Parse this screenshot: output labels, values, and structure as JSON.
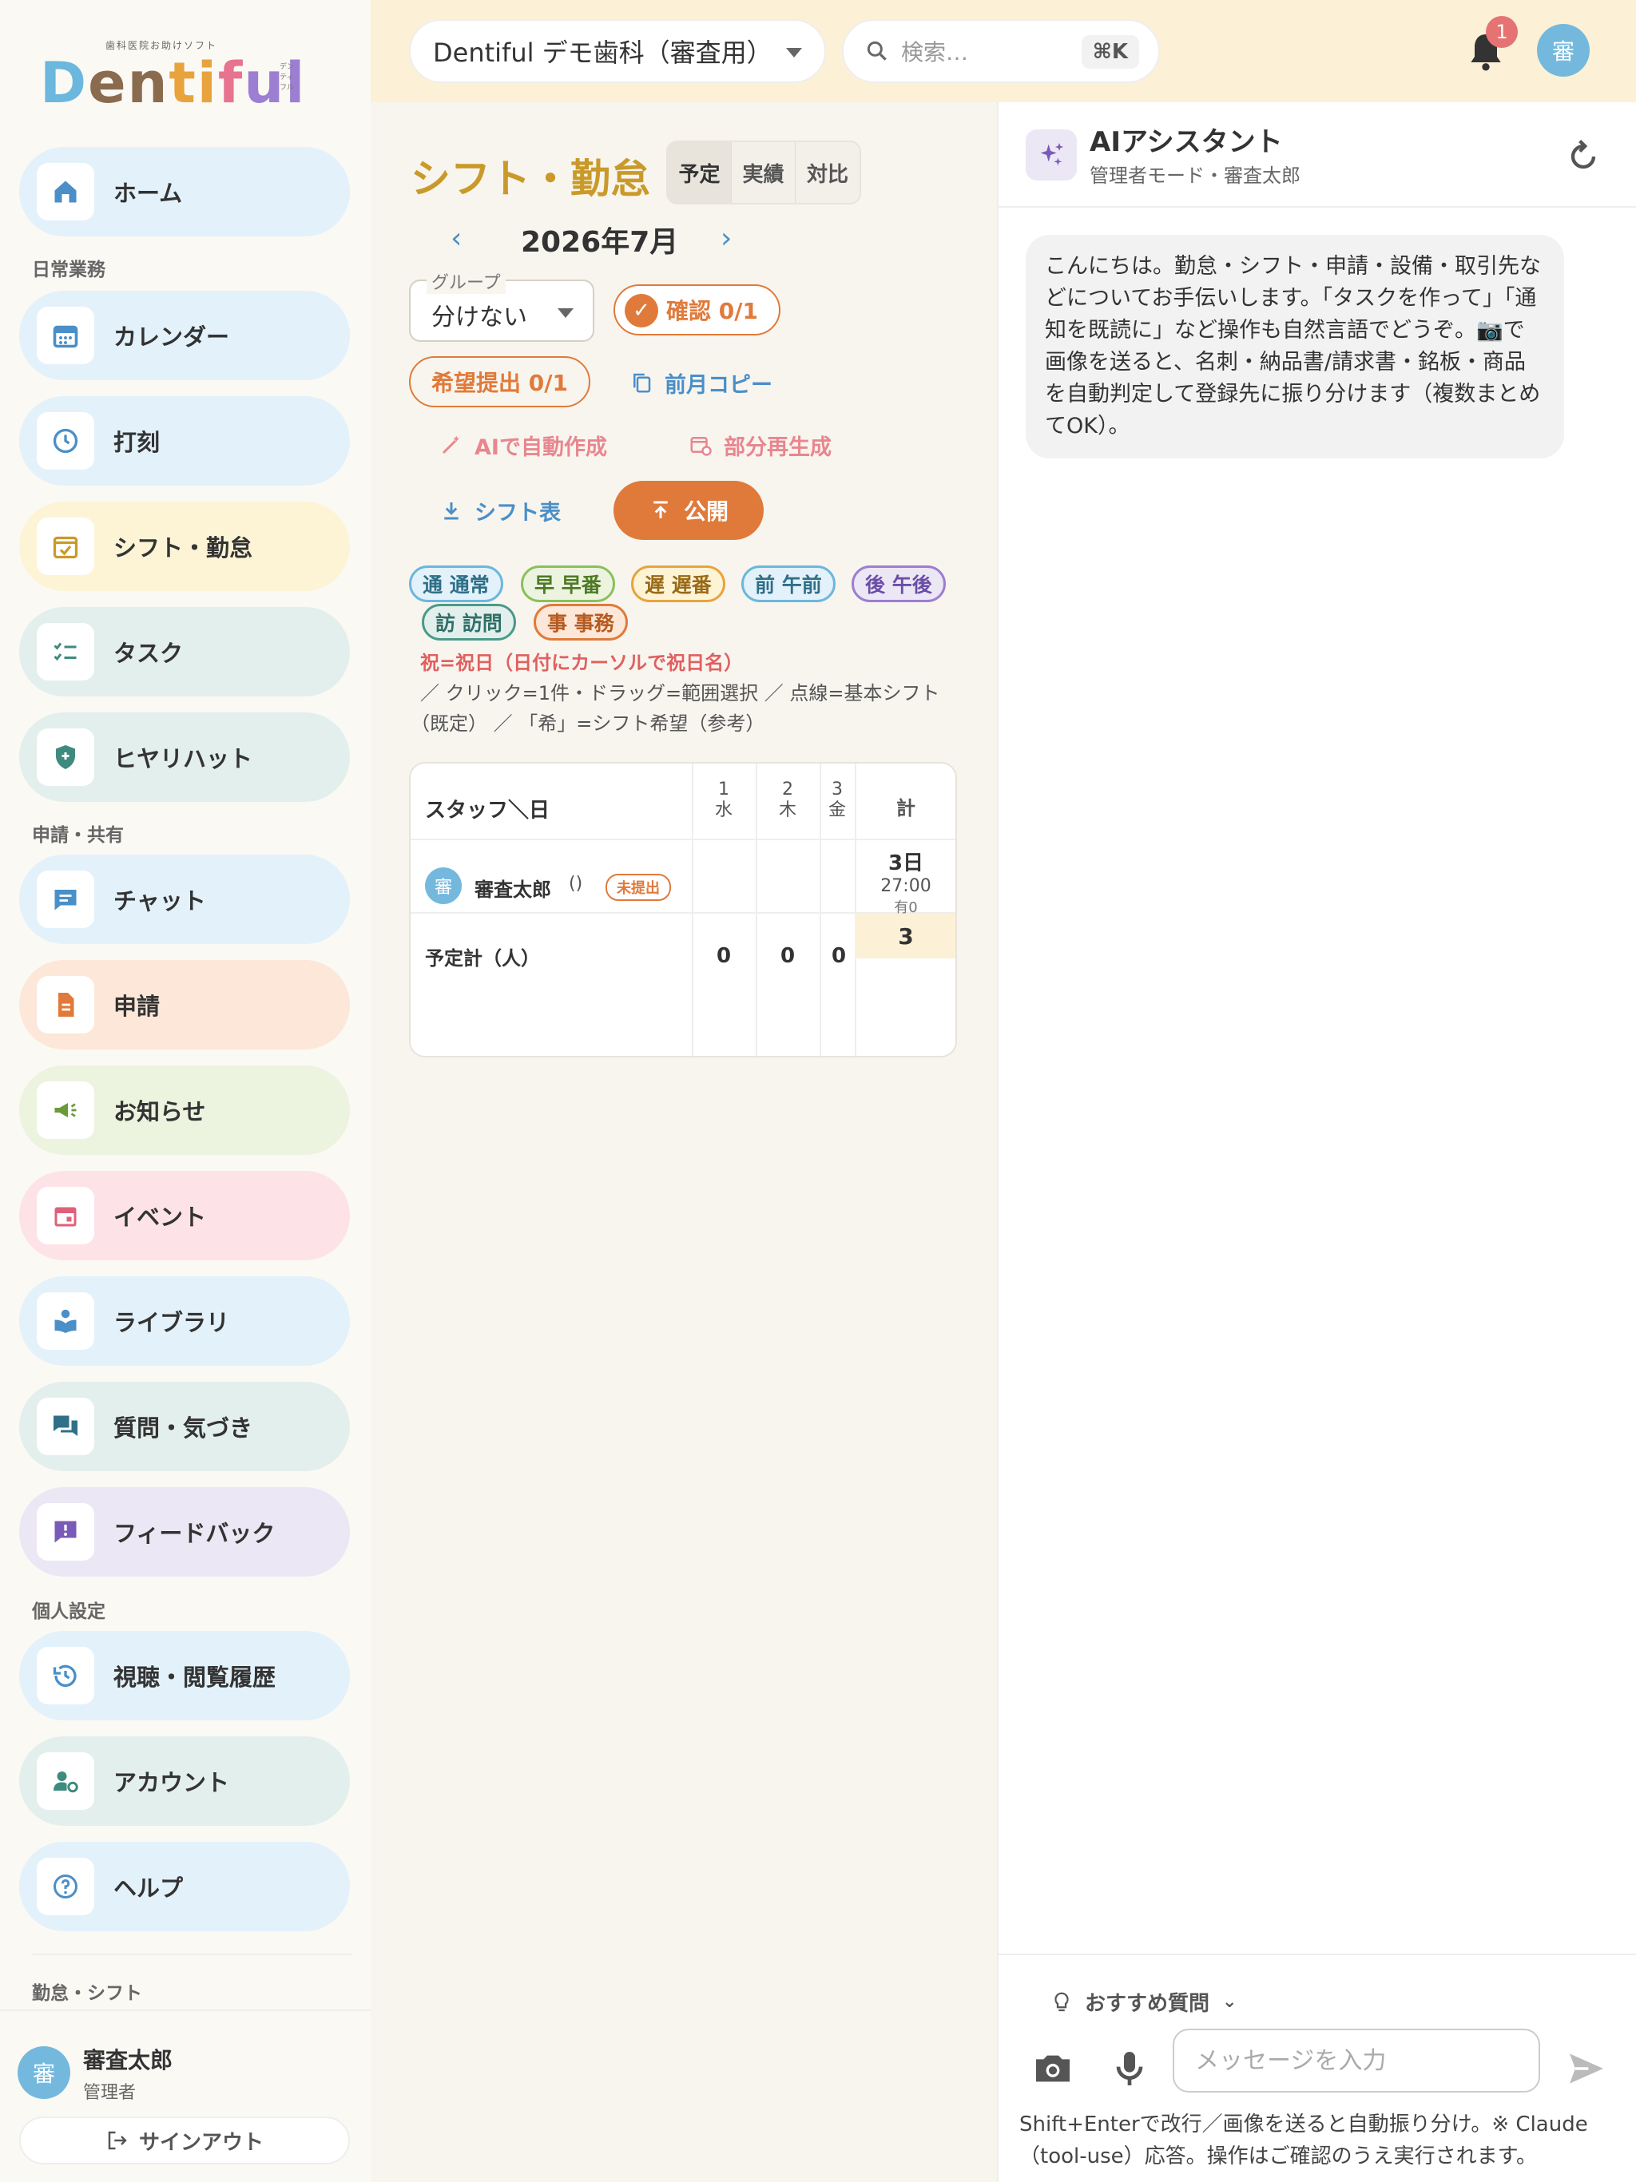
{
  "logo": {
    "tagline": "歯科医院お助けソフト",
    "wordmark": [
      "D",
      "en",
      "ti",
      "f",
      "ul"
    ],
    "ruby": "デンティフル"
  },
  "sidebar": {
    "home": "ホーム",
    "section_daily": "日常業務",
    "calendar": "カレンダー",
    "clock": "打刻",
    "shift": "シフト・勤怠",
    "task": "タスク",
    "hiyari": "ヒヤリハット",
    "section_share": "申請・共有",
    "chat": "チャット",
    "request": "申請",
    "notice": "お知らせ",
    "event": "イベント",
    "library": "ライブラリ",
    "question": "質問・気づき",
    "feedback": "フィードバック",
    "section_personal": "個人設定",
    "history": "視聴・閲覧履歴",
    "account": "アカウント",
    "help": "ヘルプ",
    "section_bottom": "勤怠・シフト"
  },
  "user": {
    "avatar": "審",
    "name": "審査太郎",
    "role": "管理者",
    "signout": "サインアウト"
  },
  "topbar": {
    "clinic": "Dentiful デモ歯科（審査用）",
    "search_placeholder": "検索…",
    "shortcut": "⌘K",
    "notif_count": "1",
    "avatar": "審"
  },
  "main": {
    "title": "シフト・勤怠",
    "tabs": [
      "予定",
      "実績",
      "対比"
    ],
    "month": "2026年7月",
    "group_label": "グループ",
    "group_value": "分けない",
    "confirm": "確認 0/1",
    "wish": "希望提出 0/1",
    "copy_prev": "前月コピー",
    "ai_create": "AIで自動作成",
    "partial_regen": "部分再生成",
    "shift_table": "シフト表",
    "publish": "公開",
    "legend": [
      "通 通常",
      "早 早番",
      "遅 遅番",
      "前 午前",
      "後 午後",
      "訪 訪問",
      "事 事務"
    ],
    "holiday_note": "祝=祝日（日付にカーソルで祝日名）",
    "help_line1": "／ クリック=1件・ドラッグ=範囲選択 ／ 点線=基本シフト",
    "help_line2": "（既定） ／ 「希」=シフト希望（参考）"
  },
  "table": {
    "header_staff": "スタッフ＼日",
    "days": [
      {
        "num": "1",
        "dow": "水"
      },
      {
        "num": "2",
        "dow": "木"
      },
      {
        "num": "3",
        "dow": "金"
      }
    ],
    "header_total": "計",
    "row": {
      "avatar": "審",
      "name": "審査太郎",
      "paren": "()",
      "badge": "未提出",
      "total_days": "3日",
      "total_hours": "27:00",
      "total_paid": "有0"
    },
    "sum_label": "予定計（人）",
    "sum_values": [
      "0",
      "0",
      "0"
    ],
    "sum_total": "3"
  },
  "chat": {
    "title": "AIアシスタント",
    "subtitle": "管理者モード・審査太郎",
    "greeting": "こんにちは。勤怠・シフト・申請・設備・取引先などについてお手伝いします。「タスクを作って」「通知を既読に」など操作も自然言語でどうぞ。📷で画像を送ると、名刺・納品書/請求書・銘板・商品を自動判定して登録先に振り分けます（複数まとめてOK）。",
    "suggest": "おすすめ質問",
    "input_placeholder": "メッセージを入力",
    "footnote": "Shift+Enterで改行／画像を送ると自動振り分け。※ Claude（tool-use）応答。操作はご確認のうえ実行されます。"
  },
  "colors": {
    "accent": "#e07a3a",
    "title": "#c99a2a",
    "link": "#4a8fc8"
  }
}
